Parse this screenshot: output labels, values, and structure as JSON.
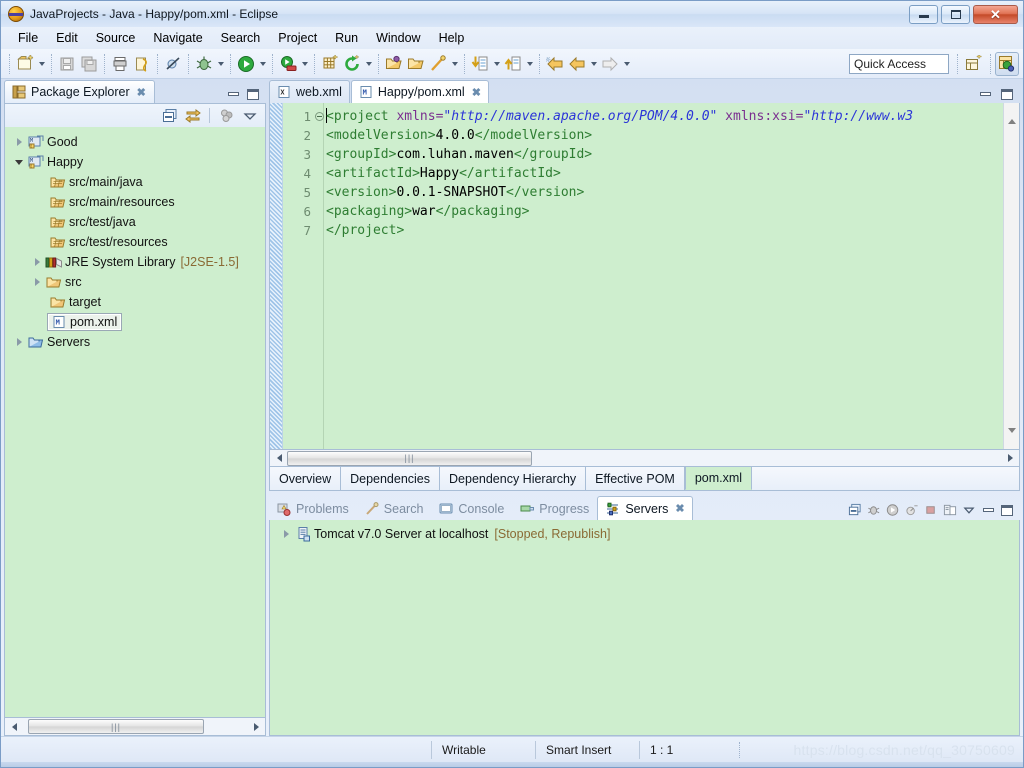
{
  "window": {
    "title": "JavaProjects - Java - Happy/pom.xml - Eclipse",
    "app_icon": "eclipse-icon",
    "minimize_label": "Minimize",
    "maximize_label": "Maximize",
    "close_label": "✕"
  },
  "menubar": {
    "items": [
      {
        "label": "File",
        "mnemonic": "F"
      },
      {
        "label": "Edit",
        "mnemonic": "E"
      },
      {
        "label": "Source",
        "mnemonic": "S"
      },
      {
        "label": "Navigate",
        "mnemonic": "N"
      },
      {
        "label": "Search",
        "mnemonic": "r"
      },
      {
        "label": "Project",
        "mnemonic": "P"
      },
      {
        "label": "Run",
        "mnemonic": "R"
      },
      {
        "label": "Window",
        "mnemonic": "W"
      },
      {
        "label": "Help",
        "mnemonic": "H"
      }
    ]
  },
  "toolbar": {
    "quick_access_placeholder": "Quick Access",
    "quick_access_value": "",
    "buttons": [
      "new-wizard-icon",
      "save-icon",
      "save-all-icon",
      "print-icon",
      "build-all-icon",
      "skip-breakpoints-icon",
      "debug-icon",
      "run-icon",
      "run-server-icon",
      "new-package-icon",
      "refresh-icon",
      "open-type-icon",
      "open-resource-icon",
      "search-icon",
      "next-annotation-icon",
      "previous-annotation-icon",
      "back-icon",
      "forward-icon"
    ],
    "perspective_new_icon": "new-perspective-icon",
    "perspective_active_icon": "java-perspective-icon"
  },
  "explorer": {
    "tab_label": "Package Explorer",
    "tab_icon": "package-explorer-icon",
    "tab_close": "✖",
    "toolbar_buttons": [
      "collapse-all-icon",
      "link-with-editor-icon",
      "view-menu-filters-icon",
      "view-menu-icon"
    ],
    "minimize_label": "Minimize",
    "maximize_label": "Maximize",
    "tree": [
      {
        "label": "Good",
        "icon": "maven-project-icon",
        "indent": 0,
        "twist": "closed",
        "sub": "",
        "selected": false
      },
      {
        "label": "Happy",
        "icon": "maven-project-icon",
        "indent": 0,
        "twist": "open",
        "sub": "",
        "selected": false
      },
      {
        "label": "src/main/java",
        "icon": "source-folder-icon",
        "indent": 1,
        "twist": "none",
        "sub": "",
        "selected": false
      },
      {
        "label": "src/main/resources",
        "icon": "source-folder-icon",
        "indent": 1,
        "twist": "none",
        "sub": "",
        "selected": false
      },
      {
        "label": "src/test/java",
        "icon": "source-folder-icon",
        "indent": 1,
        "twist": "none",
        "sub": "",
        "selected": false
      },
      {
        "label": "src/test/resources",
        "icon": "source-folder-icon",
        "indent": 1,
        "twist": "none",
        "sub": "",
        "selected": false
      },
      {
        "label": "JRE System Library",
        "icon": "library-icon",
        "indent": 1,
        "twist": "closed",
        "sub": "[J2SE-1.5]",
        "selected": false
      },
      {
        "label": "src",
        "icon": "folder-icon",
        "indent": 1,
        "twist": "closed",
        "sub": "",
        "selected": false
      },
      {
        "label": "target",
        "icon": "folder-icon",
        "indent": 1,
        "twist": "none",
        "sub": "",
        "selected": false
      },
      {
        "label": "pom.xml",
        "icon": "maven-pom-icon",
        "indent": 1,
        "twist": "none",
        "sub": "",
        "selected": true
      },
      {
        "label": "Servers",
        "icon": "folder-icon",
        "indent": 0,
        "twist": "closed",
        "sub": "",
        "selected": false
      }
    ]
  },
  "editor": {
    "tabs": [
      {
        "label": "web.xml",
        "icon": "xml-file-icon",
        "active": false,
        "close": ""
      },
      {
        "label": "Happy/pom.xml",
        "icon": "maven-pom-icon",
        "active": true,
        "close": "✖"
      }
    ],
    "minimize_label": "Minimize",
    "maximize_label": "Maximize",
    "line_numbers": [
      "1",
      "2",
      "3",
      "4",
      "5",
      "6",
      "7"
    ],
    "lines": [
      [
        {
          "t": "tag",
          "s": "<project"
        },
        {
          "t": "attr",
          "s": " xmlns="
        },
        {
          "t": "str",
          "s": "\"http://maven.apache.org/POM/4.0.0\""
        },
        {
          "t": "attr",
          "s": " xmlns:xsi="
        },
        {
          "t": "str",
          "s": "\"http://www.w3"
        }
      ],
      [
        {
          "t": "tag",
          "s": "  <modelVersion>"
        },
        {
          "t": "txt",
          "s": "4.0.0"
        },
        {
          "t": "tag",
          "s": "</modelVersion>"
        }
      ],
      [
        {
          "t": "tag",
          "s": "  <groupId>"
        },
        {
          "t": "txt",
          "s": "com.luhan.maven"
        },
        {
          "t": "tag",
          "s": "</groupId>"
        }
      ],
      [
        {
          "t": "tag",
          "s": "  <artifactId>"
        },
        {
          "t": "txt",
          "s": "Happy"
        },
        {
          "t": "tag",
          "s": "</artifactId>"
        }
      ],
      [
        {
          "t": "tag",
          "s": "  <version>"
        },
        {
          "t": "txt",
          "s": "0.0.1-SNAPSHOT"
        },
        {
          "t": "tag",
          "s": "</version>"
        }
      ],
      [
        {
          "t": "tag",
          "s": "  <packaging>"
        },
        {
          "t": "txt",
          "s": "war"
        },
        {
          "t": "tag",
          "s": "</packaging>"
        }
      ],
      [
        {
          "t": "tag",
          "s": "</project>"
        }
      ]
    ],
    "page_tabs": [
      {
        "label": "Overview",
        "active": false
      },
      {
        "label": "Dependencies",
        "active": false
      },
      {
        "label": "Dependency Hierarchy",
        "active": false
      },
      {
        "label": "Effective POM",
        "active": false
      },
      {
        "label": "pom.xml",
        "active": true
      }
    ]
  },
  "bottom": {
    "tabs": [
      {
        "label": "Problems",
        "icon": "problems-icon",
        "active": false,
        "close": ""
      },
      {
        "label": "Search",
        "icon": "search-icon",
        "active": false,
        "close": ""
      },
      {
        "label": "Console",
        "icon": "console-icon",
        "active": false,
        "close": ""
      },
      {
        "label": "Progress",
        "icon": "progress-icon",
        "active": false,
        "close": ""
      },
      {
        "label": "Servers",
        "icon": "servers-icon",
        "active": true,
        "close": "✖"
      }
    ],
    "toolbar_buttons": [
      "collapse-all-icon",
      "debug-server-icon",
      "start-server-icon",
      "profile-server-icon",
      "stop-server-icon",
      "publish-icon",
      "view-menu-icon"
    ],
    "minimize_label": "Minimize",
    "maximize_label": "Maximize",
    "servers": [
      {
        "name": "Tomcat v7.0 Server at localhost",
        "state": "[Stopped, Republish]",
        "icon": "server-icon"
      }
    ]
  },
  "statusbar": {
    "writable": "Writable",
    "insert_mode": "Smart Insert",
    "position": "1 : 1",
    "watermark": "https://blog.csdn.net/qq_30750609"
  },
  "colors": {
    "editor_background": "#ceeece",
    "tree_background": "#ceeece",
    "xml_tag": "#2e7d32",
    "xml_attribute": "#7a2f8f",
    "xml_string": "#2b34d8",
    "xml_text": "#000000",
    "state_text": "#8a6a34",
    "chrome": "#dfe8f7"
  }
}
